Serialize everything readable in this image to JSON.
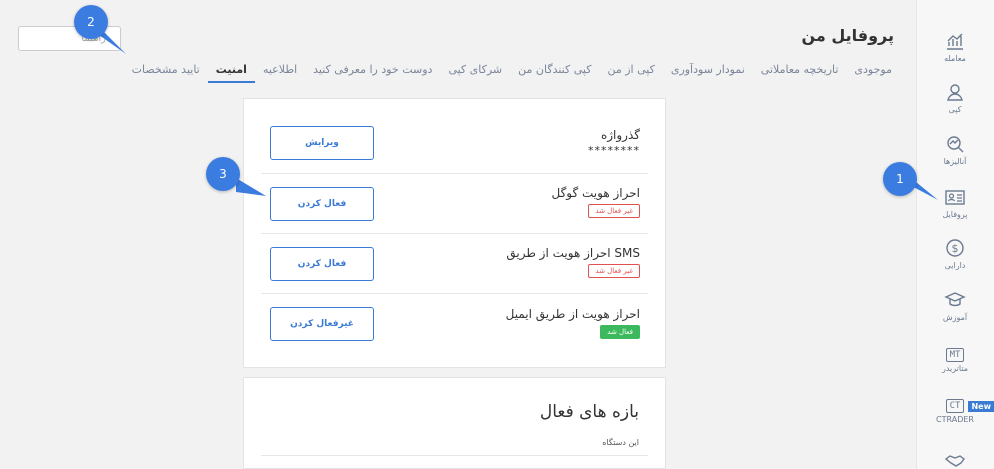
{
  "header": {
    "title": "پروفایل من",
    "search_placeholder": "راهنما"
  },
  "tabs": [
    {
      "label": "موجودی"
    },
    {
      "label": "تاریخچه معاملاتی"
    },
    {
      "label": "نمودار سودآوری"
    },
    {
      "label": "کپی از من"
    },
    {
      "label": "کپی کنندگان من"
    },
    {
      "label": "شرکای کپی"
    },
    {
      "label": "دوست خود را معرفی کنید"
    },
    {
      "label": "اطلاعیه"
    },
    {
      "label": "امنیت"
    },
    {
      "label": "تایید مشخصات"
    }
  ],
  "active_tab": "امنیت",
  "sidebar": {
    "items": [
      {
        "label": "معامله",
        "icon": "trade-chart-icon"
      },
      {
        "label": "کپی",
        "icon": "copy-user-icon"
      },
      {
        "label": "آنالیزها",
        "icon": "analytics-icon"
      },
      {
        "label": "پروفایل",
        "icon": "profile-card-icon"
      },
      {
        "label": "دارایی",
        "icon": "dollar-icon"
      },
      {
        "label": "آموزش",
        "icon": "graduation-cap-icon"
      },
      {
        "label": "متاتریدر",
        "badge": "MT"
      },
      {
        "label": "CTRADER",
        "badge": "CT"
      }
    ],
    "new_badge": "New"
  },
  "security": {
    "password": {
      "label": "گذرواژه",
      "value": "********",
      "button": "ویرایش"
    },
    "google": {
      "label": "احراز هویت گوگل",
      "status": "غیر فعال شد",
      "button": "فعال کردن"
    },
    "sms": {
      "label": "احراز هویت از طریق SMS",
      "status": "غیر فعال شد",
      "button": "فعال کردن"
    },
    "email": {
      "label": "احراز هویت از طریق ایمیل",
      "status": "فعال شد",
      "button": "غیرفعال کردن"
    }
  },
  "sessions": {
    "title": "بازه های فعال",
    "subtitle": "این دستگاه"
  },
  "callouts": {
    "one": "1",
    "two": "2",
    "three": "3"
  },
  "colors": {
    "accent": "#3a7bd5",
    "danger": "#e05252",
    "success": "#3cb95c",
    "callout": "#3b7ce0"
  }
}
